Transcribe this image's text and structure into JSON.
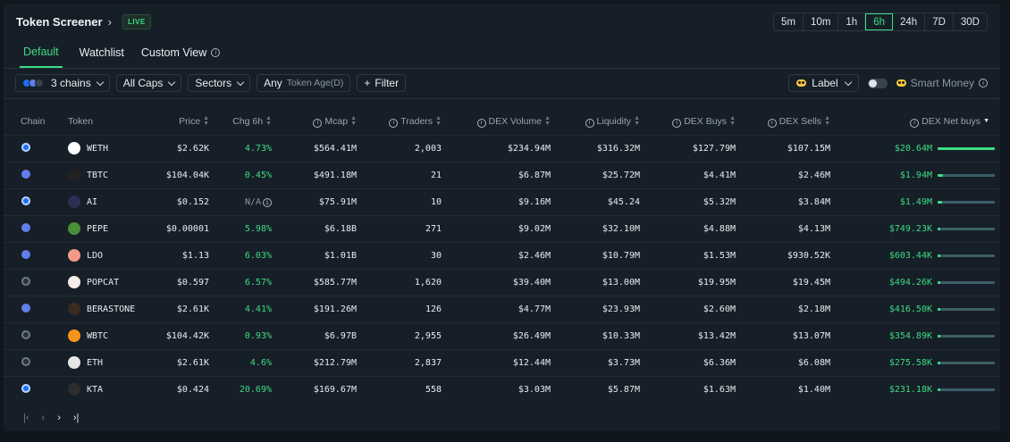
{
  "header": {
    "title": "Token Screener",
    "title_chevron": "›",
    "live_badge": "LIVE"
  },
  "timeframes": {
    "options": [
      "5m",
      "10m",
      "1h",
      "6h",
      "24h",
      "7D",
      "30D"
    ],
    "selected": "6h"
  },
  "tabs": [
    {
      "label": "Default",
      "active": true
    },
    {
      "label": "Watchlist",
      "active": false
    },
    {
      "label": "Custom View",
      "active": false,
      "info_icon": "info-icon"
    }
  ],
  "filters": {
    "chains": "3 chains",
    "caps": "All Caps",
    "sectors": "Sectors",
    "age_value": "Any",
    "age_label": "Token Age(D)",
    "add_filter": "Filter",
    "add_icon": "+"
  },
  "tools": {
    "label": "Label",
    "smart_money": "Smart Money",
    "smart_money_enabled": false
  },
  "table": {
    "columns": {
      "chain": "Chain",
      "token": "Token",
      "price": "Price",
      "chg": "Chg 6h",
      "mcap": "Mcap",
      "traders": "Traders",
      "dex_volume": "DEX Volume",
      "liquidity": "Liquidity",
      "dex_buys": "DEX Buys",
      "dex_sells": "DEX Sells",
      "dex_net_buys": "DEX Net buys"
    },
    "rows": [
      {
        "chain": "base",
        "token": "WETH",
        "price": "$2.62K",
        "chg": "4.73%",
        "mcap": "$564.41M",
        "traders": "2,003",
        "dex_volume": "$234.94M",
        "liquidity": "$316.32M",
        "dex_buys": "$127.79M",
        "dex_sells": "$107.15M",
        "net_buys": "$20.64M",
        "net_share": 1.0
      },
      {
        "chain": "ethereum",
        "token": "TBTC",
        "price": "$104.04K",
        "chg": "0.45%",
        "mcap": "$491.18M",
        "traders": "21",
        "dex_volume": "$6.87M",
        "liquidity": "$25.72M",
        "dex_buys": "$4.41M",
        "dex_sells": "$2.46M",
        "net_buys": "$1.94M",
        "net_share": 0.094
      },
      {
        "chain": "base",
        "token": "AI",
        "price": "$0.152",
        "chg": "N/A",
        "mcap": "$75.91M",
        "traders": "10",
        "dex_volume": "$9.16M",
        "liquidity": "$45.24",
        "dex_buys": "$5.32M",
        "dex_sells": "$3.84M",
        "net_buys": "$1.49M",
        "net_share": 0.072
      },
      {
        "chain": "ethereum",
        "token": "PEPE",
        "price": "$0.00001",
        "chg": "5.98%",
        "mcap": "$6.18B",
        "traders": "271",
        "dex_volume": "$9.02M",
        "liquidity": "$32.10M",
        "dex_buys": "$4.88M",
        "dex_sells": "$4.13M",
        "net_buys": "$749.23K",
        "net_share": 0.036
      },
      {
        "chain": "ethereum",
        "token": "LDO",
        "price": "$1.13",
        "chg": "6.03%",
        "mcap": "$1.01B",
        "traders": "30",
        "dex_volume": "$2.46M",
        "liquidity": "$10.79M",
        "dex_buys": "$1.53M",
        "dex_sells": "$930.52K",
        "net_buys": "$603.44K",
        "net_share": 0.029
      },
      {
        "chain": "solana",
        "token": "POPCAT",
        "price": "$0.597",
        "chg": "6.57%",
        "mcap": "$585.77M",
        "traders": "1,620",
        "dex_volume": "$39.40M",
        "liquidity": "$13.00M",
        "dex_buys": "$19.95M",
        "dex_sells": "$19.45M",
        "net_buys": "$494.26K",
        "net_share": 0.024
      },
      {
        "chain": "ethereum",
        "token": "BERASTONE",
        "price": "$2.61K",
        "chg": "4.41%",
        "mcap": "$191.26M",
        "traders": "126",
        "dex_volume": "$4.77M",
        "liquidity": "$23.93M",
        "dex_buys": "$2.60M",
        "dex_sells": "$2.18M",
        "net_buys": "$416.50K",
        "net_share": 0.02
      },
      {
        "chain": "solana",
        "token": "WBTC",
        "price": "$104.42K",
        "chg": "0.93%",
        "mcap": "$6.97B",
        "traders": "2,955",
        "dex_volume": "$26.49M",
        "liquidity": "$10.33M",
        "dex_buys": "$13.42M",
        "dex_sells": "$13.07M",
        "net_buys": "$354.89K",
        "net_share": 0.017
      },
      {
        "chain": "solana",
        "token": "ETH",
        "price": "$2.61K",
        "chg": "4.6%",
        "mcap": "$212.79M",
        "traders": "2,837",
        "dex_volume": "$12.44M",
        "liquidity": "$3.73M",
        "dex_buys": "$6.36M",
        "dex_sells": "$6.08M",
        "net_buys": "$275.58K",
        "net_share": 0.013
      },
      {
        "chain": "base",
        "token": "KTA",
        "price": "$0.424",
        "chg": "20.69%",
        "mcap": "$169.67M",
        "traders": "558",
        "dex_volume": "$3.03M",
        "liquidity": "$5.87M",
        "dex_buys": "$1.63M",
        "dex_sells": "$1.40M",
        "net_buys": "$231.18K",
        "net_share": 0.011
      }
    ]
  },
  "pager": {
    "first": "|‹",
    "prev": "‹",
    "next": "›",
    "last": "›|"
  },
  "colors": {
    "accent": "#3ddc84",
    "base": "#1e6ff0",
    "ethereum": "#627eea",
    "solana": "#2b2f36"
  }
}
